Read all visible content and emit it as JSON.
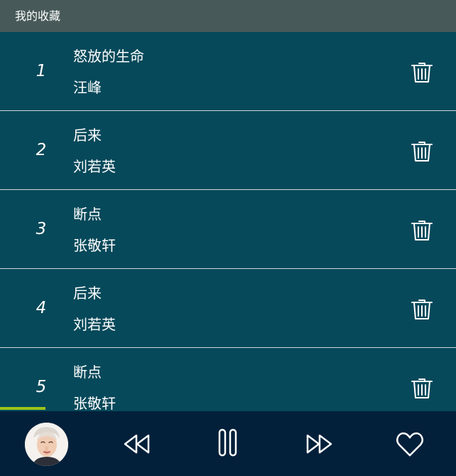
{
  "header": {
    "title": "我的收藏"
  },
  "favorites": [
    {
      "index": "1",
      "title": "怒放的生命",
      "artist": "汪峰"
    },
    {
      "index": "2",
      "title": "后来",
      "artist": "刘若英"
    },
    {
      "index": "3",
      "title": "断点",
      "artist": "张敬轩"
    },
    {
      "index": "4",
      "title": "后来",
      "artist": "刘若英"
    },
    {
      "index": "5",
      "title": "断点",
      "artist": "张敬轩"
    }
  ],
  "player": {
    "progress_fraction": 0.1,
    "state": "playing",
    "icons": [
      "album-avatar",
      "rewind-icon",
      "pause-icon",
      "fast-forward-icon",
      "heart-icon"
    ]
  },
  "colors": {
    "header_bg": "#475a59",
    "list_bg": "#06495a",
    "player_bg": "#02203a",
    "progress": "#9bc41c",
    "divider": "#cfd8da",
    "text": "#ffffff"
  }
}
